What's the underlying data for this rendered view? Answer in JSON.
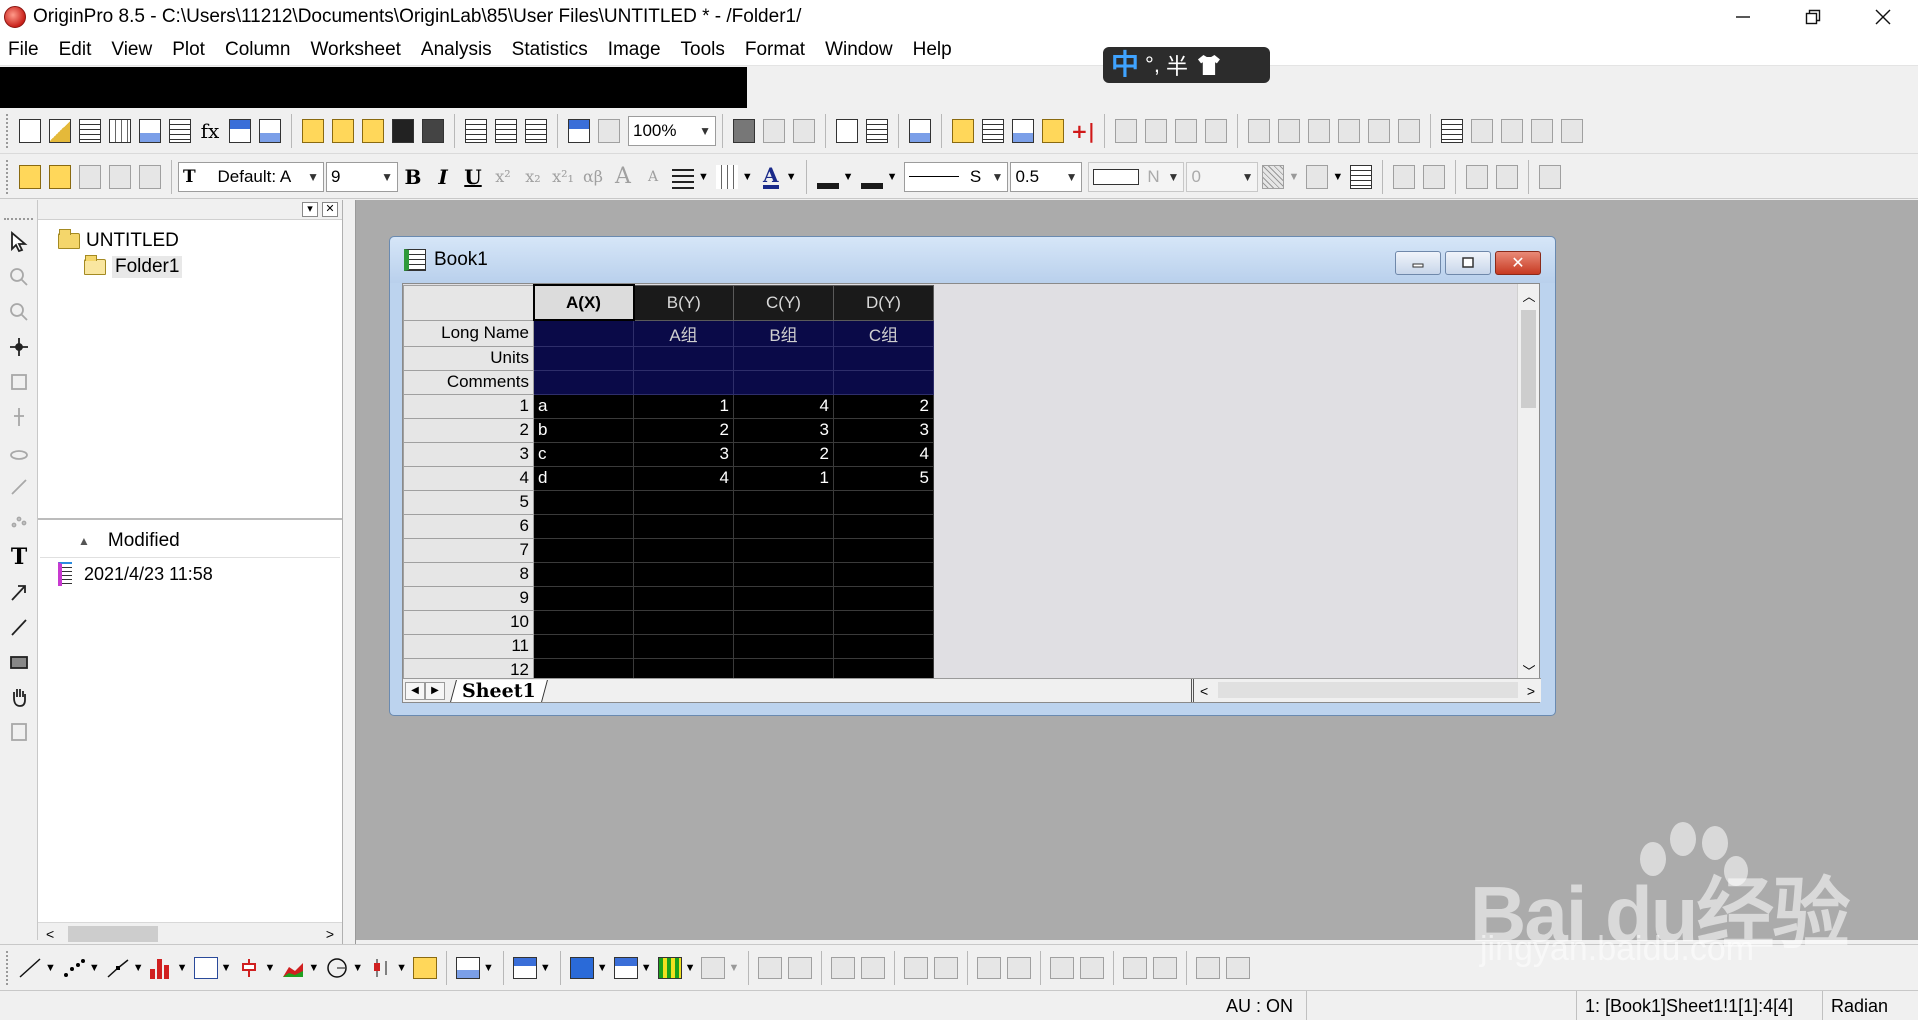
{
  "titlebar": {
    "title": "OriginPro 8.5 - C:\\Users\\11212\\Documents\\OriginLab\\85\\User Files\\UNTITLED * - /Folder1/"
  },
  "menu": [
    "File",
    "Edit",
    "View",
    "Plot",
    "Column",
    "Worksheet",
    "Analysis",
    "Statistics",
    "Image",
    "Tools",
    "Format",
    "Window",
    "Help"
  ],
  "ime": {
    "mode": "中",
    "punct": "°,",
    "width": "半"
  },
  "toolbar1": {
    "zoom": "100%"
  },
  "toolbar2": {
    "font": "Default: A",
    "font_size": "9",
    "bold": "B",
    "italic": "I",
    "underline": "U",
    "line_style_label": "S",
    "line_width": "0.5",
    "pattern_label": "N",
    "pattern_value": "0"
  },
  "project_explorer": {
    "root": "UNTITLED",
    "folder": "Folder1",
    "list_header": "Modified",
    "list_item_modified": "2021/4/23 11:58"
  },
  "book": {
    "title": "Book1",
    "sheet_tab": "Sheet1",
    "columns": [
      "A(X)",
      "B(Y)",
      "C(Y)",
      "D(Y)"
    ],
    "meta_rows": [
      {
        "label": "Long Name",
        "values": [
          "",
          "A组",
          "B组",
          "C组"
        ]
      },
      {
        "label": "Units",
        "values": [
          "",
          "",
          "",
          ""
        ]
      },
      {
        "label": "Comments",
        "values": [
          "",
          "",
          "",
          ""
        ]
      }
    ],
    "rows": [
      {
        "n": "1",
        "values": [
          "a",
          "1",
          "4",
          "2"
        ]
      },
      {
        "n": "2",
        "values": [
          "b",
          "2",
          "3",
          "3"
        ]
      },
      {
        "n": "3",
        "values": [
          "c",
          "3",
          "2",
          "4"
        ]
      },
      {
        "n": "4",
        "values": [
          "d",
          "4",
          "1",
          "5"
        ]
      },
      {
        "n": "5",
        "values": [
          "",
          "",
          "",
          ""
        ]
      },
      {
        "n": "6",
        "values": [
          "",
          "",
          "",
          ""
        ]
      },
      {
        "n": "7",
        "values": [
          "",
          "",
          "",
          ""
        ]
      },
      {
        "n": "8",
        "values": [
          "",
          "",
          "",
          ""
        ]
      },
      {
        "n": "9",
        "values": [
          "",
          "",
          "",
          ""
        ]
      },
      {
        "n": "10",
        "values": [
          "",
          "",
          "",
          ""
        ]
      },
      {
        "n": "11",
        "values": [
          "",
          "",
          "",
          ""
        ]
      },
      {
        "n": "12",
        "values": [
          "",
          "",
          "",
          ""
        ]
      }
    ]
  },
  "status": {
    "au": "AU : ON",
    "cell_ref": "1: [Book1]Sheet1!1[1]:4[4]",
    "angle": "Radian"
  },
  "watermark": {
    "brand": "Bai  du经验",
    "url": "jingyan.baidu.com"
  }
}
